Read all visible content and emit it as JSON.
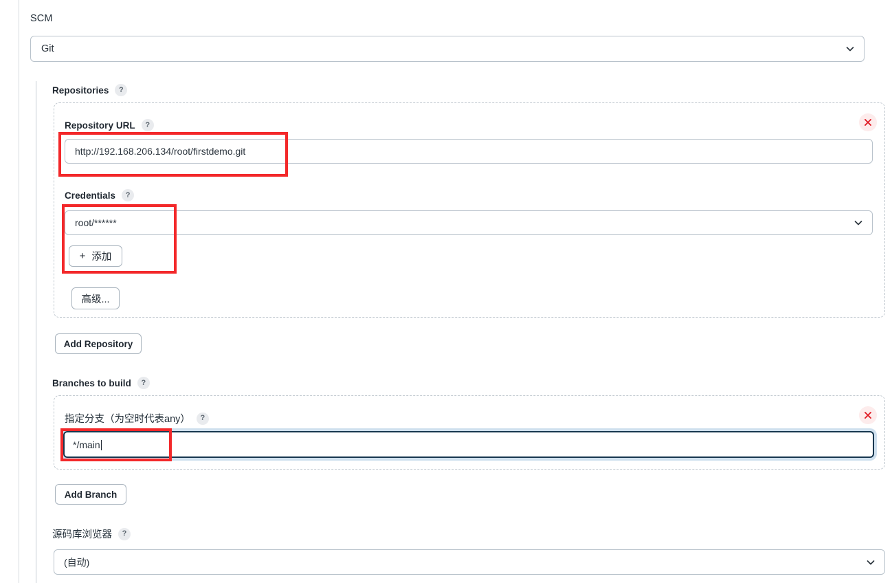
{
  "scm": {
    "label": "SCM",
    "selected": "Git",
    "chevron_icon": "chevron-down-icon"
  },
  "repositories": {
    "label": "Repositories",
    "help": "?",
    "repository_url": {
      "label": "Repository URL",
      "help": "?",
      "value": "http://192.168.206.134/root/firstdemo.git"
    },
    "credentials": {
      "label": "Credentials",
      "help": "?",
      "value": "root/******",
      "add_button": "添加",
      "add_icon": "plus-icon"
    },
    "advanced_button": "高级...",
    "remove_icon": "close-icon",
    "add_repository_button": "Add Repository"
  },
  "branches": {
    "label": "Branches to build",
    "help": "?",
    "branch_specifier": {
      "label": "指定分支（为空时代表any）",
      "help": "?",
      "value": "*/main"
    },
    "remove_icon": "close-icon",
    "add_branch_button": "Add Branch"
  },
  "repository_browser": {
    "label": "源码库浏览器",
    "help": "?",
    "selected": "(自动)",
    "chevron_icon": "chevron-down-icon"
  },
  "colors": {
    "highlight": "#f3282a",
    "focus_border": "#17374f",
    "focus_glow": "#cfe0ee",
    "remove_bg": "#fdecec",
    "remove_glyph": "#e01b24",
    "border": "#b8c2cb",
    "dashed_border": "#c0c8cf"
  }
}
